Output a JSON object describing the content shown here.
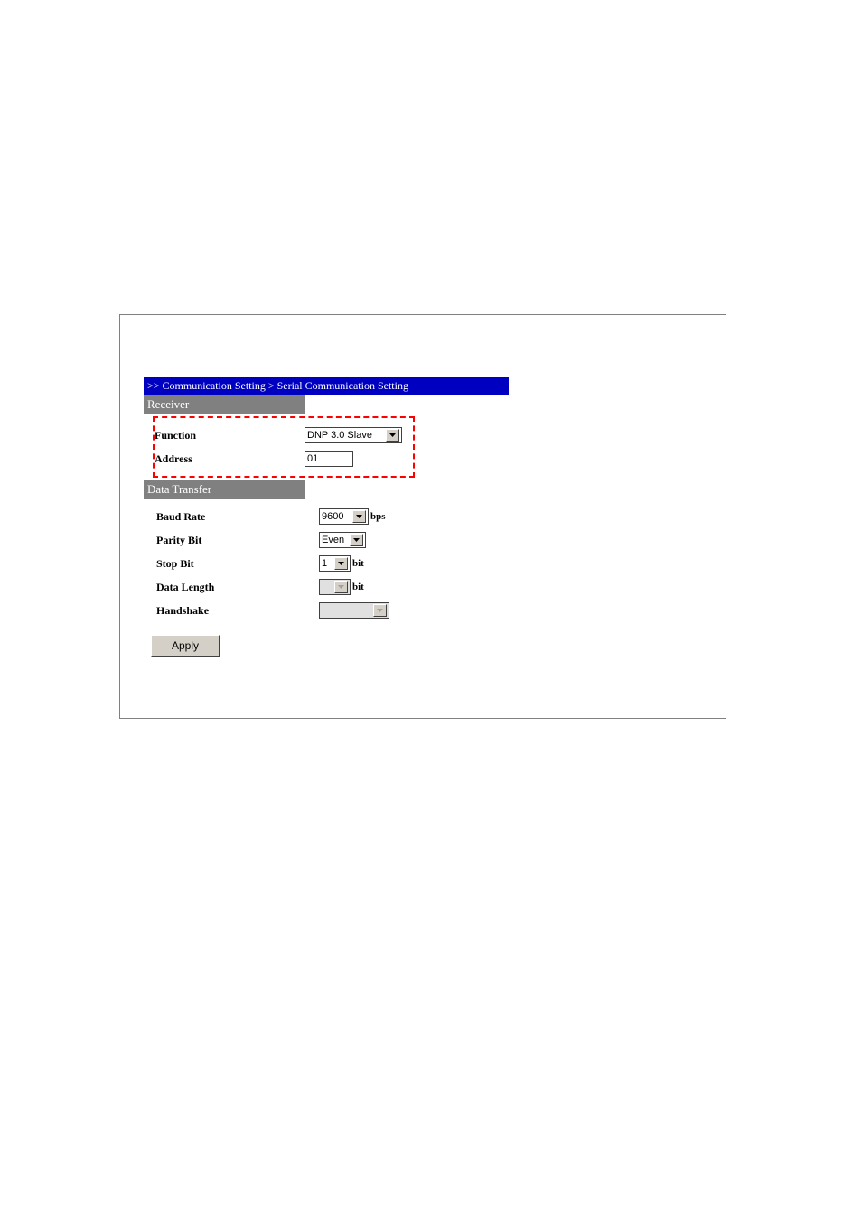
{
  "breadcrumb": ">> Communication Setting > Serial Communication Setting",
  "sections": {
    "receiver": {
      "title": "Receiver",
      "function": {
        "label": "Function",
        "value": "DNP 3.0 Slave"
      },
      "address": {
        "label": "Address",
        "value": "01"
      }
    },
    "data_transfer": {
      "title": "Data Transfer",
      "baud_rate": {
        "label": "Baud Rate",
        "value": "9600",
        "unit": "bps"
      },
      "parity_bit": {
        "label": "Parity Bit",
        "value": "Even"
      },
      "stop_bit": {
        "label": "Stop Bit",
        "value": "1",
        "unit": "bit"
      },
      "data_length": {
        "label": "Data Length",
        "value": "",
        "unit": "bit"
      },
      "handshake": {
        "label": "Handshake",
        "value": ""
      }
    }
  },
  "apply_label": "Apply"
}
